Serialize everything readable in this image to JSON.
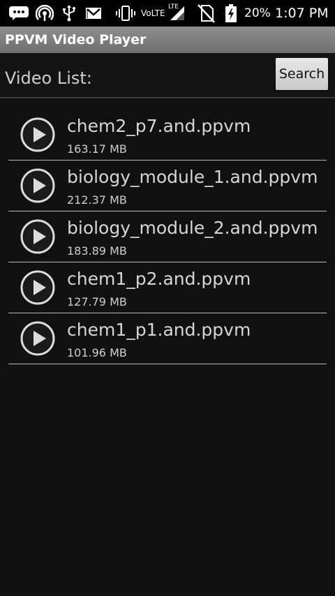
{
  "status_bar": {
    "volte": "VoLTE",
    "lte": "LTE",
    "battery_percent": "20%",
    "time": "1:07 PM",
    "icons": [
      "message-icon",
      "hotspot-icon",
      "usb-icon",
      "gmail-icon",
      "vibrate-icon",
      "signal-icon",
      "no-sim-icon",
      "battery-charging-icon"
    ]
  },
  "app": {
    "title": "PPVM Video Player",
    "title_bar_color": "#7f7f7f"
  },
  "header": {
    "label": "Video List:",
    "search_label": "Search"
  },
  "videos": [
    {
      "name": "chem2_p7.and.ppvm",
      "size": "163.17 MB",
      "icon": "play-icon"
    },
    {
      "name": "biology_module_1.and.ppvm",
      "size": "212.37 MB",
      "icon": "play-icon"
    },
    {
      "name": "biology_module_2.and.ppvm",
      "size": "183.89 MB",
      "icon": "play-icon"
    },
    {
      "name": "chem1_p2.and.ppvm",
      "size": "127.79 MB",
      "icon": "play-icon"
    },
    {
      "name": "chem1_p1.and.ppvm",
      "size": "101.96 MB",
      "icon": "play-icon"
    }
  ]
}
